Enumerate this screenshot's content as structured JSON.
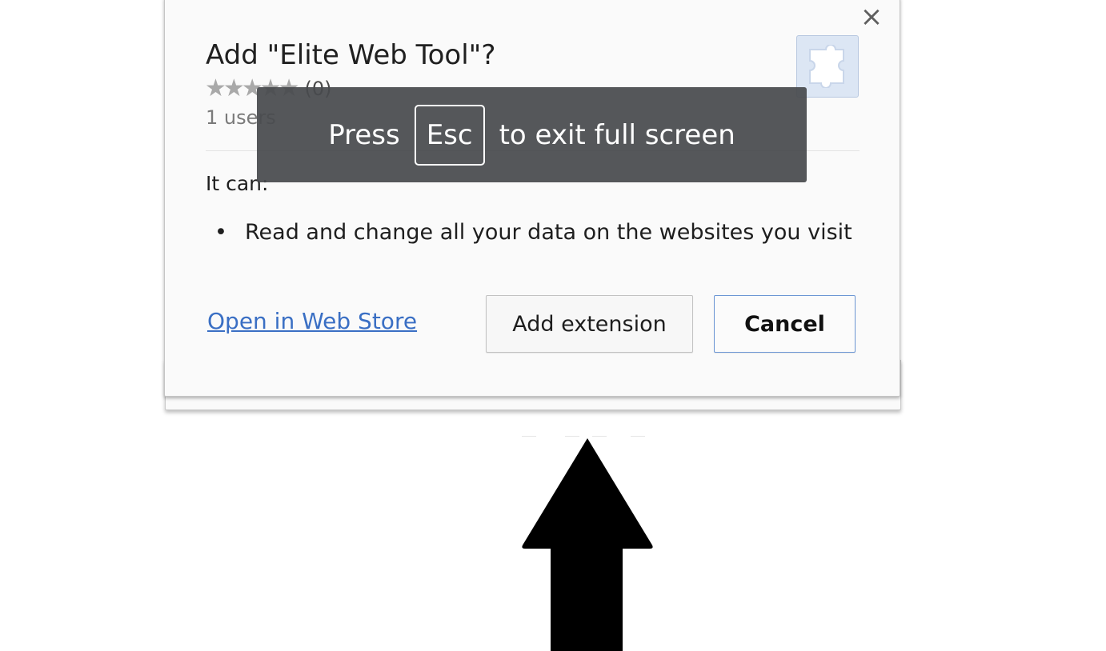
{
  "dialog": {
    "title": "Add \"Elite Web Tool\"?",
    "close_glyph": "×",
    "rating": {
      "stars": "★★★★★",
      "value": 0,
      "count_label": "(0)"
    },
    "users_label": "1 users",
    "icon": "puzzle-piece-icon",
    "permissions_heading": "It can:",
    "permissions": [
      "Read and change all your data on the websites you visit"
    ],
    "bullet": "•",
    "store_link_label": "Open in Web Store",
    "add_button_label": "Add extension",
    "cancel_button_label": "Cancel"
  },
  "fullscreen_toast": {
    "prefix": "Press",
    "key": "Esc",
    "suffix": "to exit full screen"
  },
  "overlay": {
    "arrow": "up-arrow-icon"
  },
  "colors": {
    "link": "#3a6fc4",
    "cancel_border": "#6d97d4",
    "toast_bg": "#484a4e",
    "star": "#a9a9a9",
    "icon_bg": "#dce6f4"
  }
}
